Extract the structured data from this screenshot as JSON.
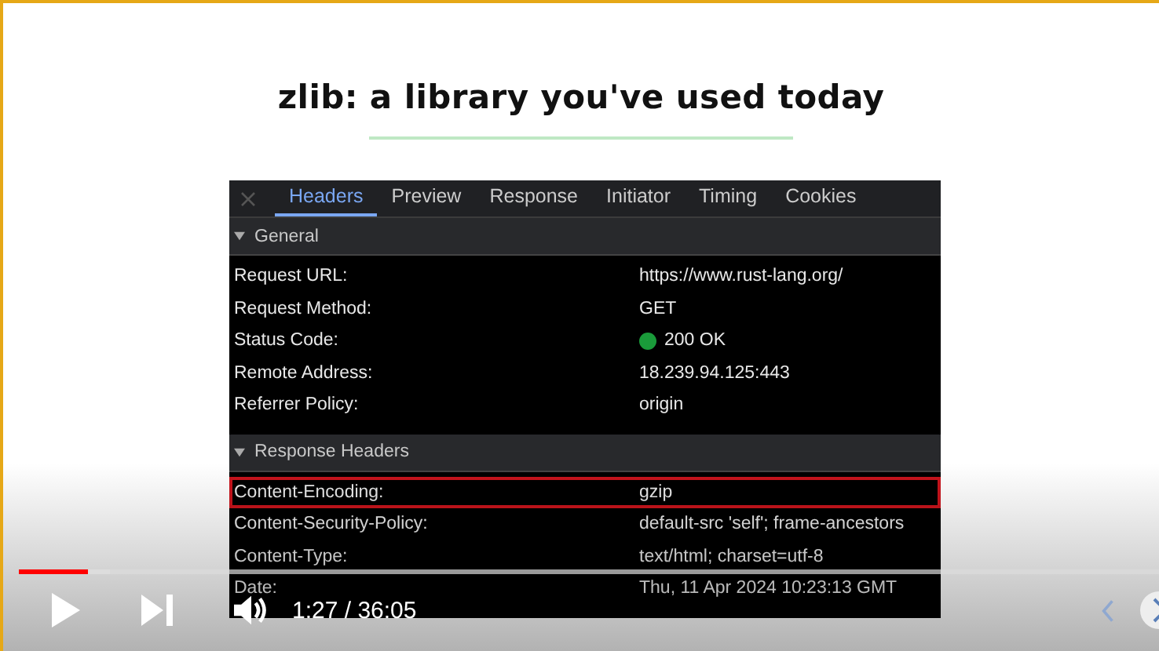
{
  "slide": {
    "title": "zlib: a library you've used today",
    "devtools": {
      "tabs": [
        {
          "label": "Headers",
          "selected": true
        },
        {
          "label": "Preview",
          "selected": false
        },
        {
          "label": "Response",
          "selected": false
        },
        {
          "label": "Initiator",
          "selected": false
        },
        {
          "label": "Timing",
          "selected": false
        },
        {
          "label": "Cookies",
          "selected": false
        }
      ],
      "sections": [
        {
          "title": "General",
          "expanded": true,
          "rows": [
            {
              "name": "Request URL:",
              "value": "https://www.rust-lang.org/",
              "highlighted": false
            },
            {
              "name": "Request Method:",
              "value": "GET",
              "highlighted": false
            },
            {
              "name": "Status Code:",
              "value": "200 OK",
              "color": "#1a9b3a",
              "highlighted": false
            },
            {
              "name": "Remote Address:",
              "value": "18.239.94.125:443",
              "highlighted": false
            },
            {
              "name": "Referrer Policy:",
              "value": "origin",
              "highlighted": false
            }
          ]
        },
        {
          "title": "Response Headers",
          "expanded": true,
          "rows": [
            {
              "name": "Content-Encoding:",
              "value": "gzip",
              "highlighted": true
            },
            {
              "name": "Content-Security-Policy:",
              "value": "default-src 'self'; frame-ancestors",
              "highlighted": false
            },
            {
              "name": "Content-Type:",
              "value": "text/html; charset=utf-8",
              "highlighted": false
            },
            {
              "name": "Date:",
              "value": "Thu, 11 Apr 2024 10:23:13 GMT",
              "highlighted": false
            }
          ]
        }
      ]
    }
  },
  "player": {
    "progress": {
      "level": 0.06
    },
    "time": "1:27 / 36:05"
  }
}
